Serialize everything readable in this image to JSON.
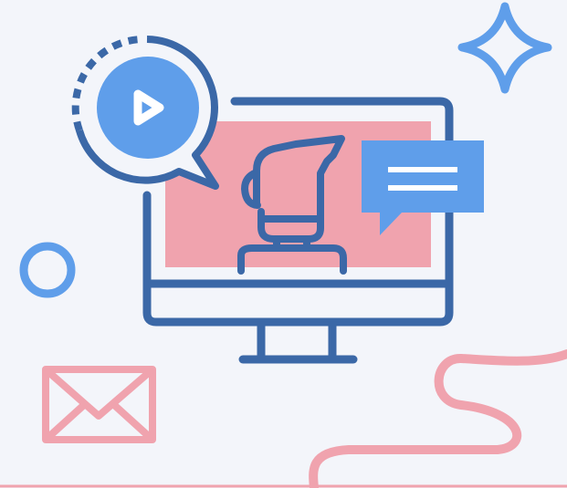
{
  "illustration": {
    "background_color": "#f3f5fa",
    "colors": {
      "navy": "#3b68a7",
      "blue": "#5f9eea",
      "pink": "#f0a3ae",
      "white": "#ffffff"
    },
    "elements": {
      "monitor": "monitor-icon",
      "screen": "video-call-screen",
      "person": "person-avatar-icon",
      "chat_bubble": "chat-bubble-icon",
      "play_badge": "play-button-icon",
      "sparkle": "sparkle-star-icon",
      "ring": "circle-outline-icon",
      "envelope": "envelope-icon",
      "squiggle": "wavy-line-decoration"
    }
  }
}
